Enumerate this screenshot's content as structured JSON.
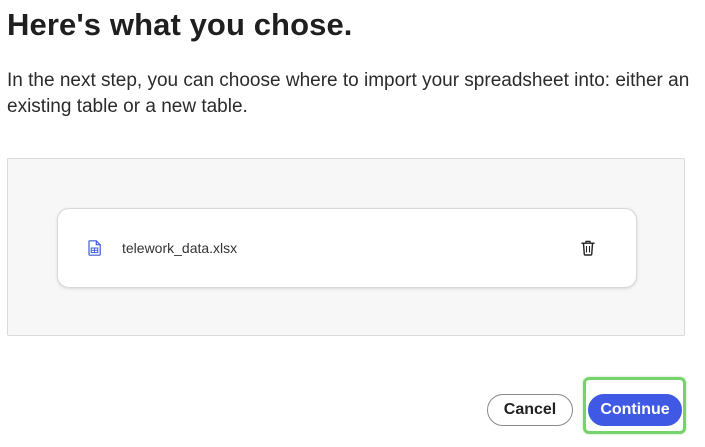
{
  "header": {
    "title": "Here's what you chose."
  },
  "body": {
    "description": "In the next step, you can choose where to import your spreadsheet into: either an existing table or a new table."
  },
  "file": {
    "icon": "spreadsheet-file-icon",
    "name": "telework_data.xlsx",
    "delete_icon": "trash-icon"
  },
  "actions": {
    "cancel_label": "Cancel",
    "continue_label": "Continue"
  },
  "colors": {
    "primary": "#3f59e4",
    "focus_ring": "#76d36b",
    "panel_bg": "#f7f7f7"
  }
}
